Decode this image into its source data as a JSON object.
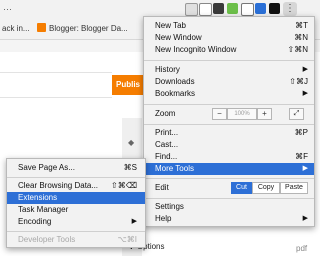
{
  "toolbar": {
    "menu_icon": "vertical-ellipsis-icon"
  },
  "bookmarks": {
    "items": [
      {
        "label": "ack in...",
        "icon": "bookmark-favicon"
      },
      {
        "label": "Blogger: Blogger Da...",
        "icon": "blogger-icon"
      }
    ]
  },
  "page": {
    "publish_label": "Publis",
    "options_label": "Options",
    "pdf_label": "pdf"
  },
  "chrome_menu": {
    "new_tab": {
      "label": "New Tab",
      "shortcut": "⌘T"
    },
    "new_window": {
      "label": "New Window",
      "shortcut": "⌘N"
    },
    "new_incognito": {
      "label": "New Incognito Window",
      "shortcut": "⇧⌘N"
    },
    "history": {
      "label": "History"
    },
    "downloads": {
      "label": "Downloads",
      "shortcut": "⇧⌘J"
    },
    "bookmarks": {
      "label": "Bookmarks"
    },
    "zoom": {
      "label": "Zoom",
      "minus": "−",
      "level": "100%",
      "plus": "+"
    },
    "print": {
      "label": "Print...",
      "shortcut": "⌘P"
    },
    "cast": {
      "label": "Cast..."
    },
    "find": {
      "label": "Find...",
      "shortcut": "⌘F"
    },
    "more_tools": {
      "label": "More Tools"
    },
    "edit": {
      "label": "Edit",
      "cut": "Cut",
      "copy": "Copy",
      "paste": "Paste"
    },
    "settings": {
      "label": "Settings"
    },
    "help": {
      "label": "Help"
    }
  },
  "more_tools_menu": {
    "save_page": {
      "label": "Save Page As...",
      "shortcut": "⌘S"
    },
    "clear_browsing": {
      "label": "Clear Browsing Data...",
      "shortcut": "⇧⌘⌫"
    },
    "extensions": {
      "label": "Extensions"
    },
    "task_manager": {
      "label": "Task Manager"
    },
    "encoding": {
      "label": "Encoding"
    },
    "developer_tools": {
      "label": "Developer Tools",
      "shortcut": "⌥⌘I"
    }
  },
  "colors": {
    "highlight": "#2d6fd6",
    "publish": "#f57d00"
  }
}
